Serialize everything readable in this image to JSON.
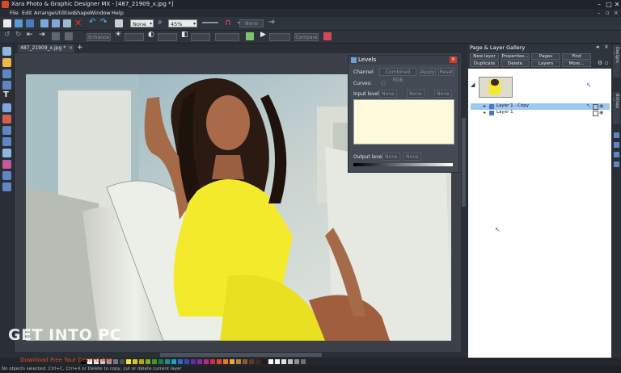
{
  "window": {
    "title": "Xara Photo & Graphic Designer MX - [487_21909_x.jpg *]",
    "controls": [
      "–",
      "□",
      "✕"
    ]
  },
  "menu": [
    "File",
    "Edit",
    "Arrange",
    "Utilities",
    "Shape",
    "Window",
    "Help"
  ],
  "toolbar": {
    "line_style": "None",
    "zoom": "45%",
    "shadow_field": "None"
  },
  "toolbar2": {
    "btn_enhance": "Enhance",
    "btn_compare": "Compare"
  },
  "document_tab": {
    "label": "487_21909_x.jpg *",
    "add": "+"
  },
  "levels": {
    "title": "Levels",
    "channel_label": "Channel",
    "channel_value": "Combined RGB",
    "auto_button": "Apply",
    "reset_button": "Reset",
    "curves_label": "Curves:",
    "input_label": "Input levels:",
    "output_label": "Output levels:",
    "input_fields": [
      "None",
      "None",
      "None"
    ],
    "output_fields": [
      "None",
      "None"
    ]
  },
  "gallery": {
    "title": "Page & Layer Gallery",
    "buttons_row1": [
      "New layer",
      "Properties...",
      "Pages",
      "Find"
    ],
    "buttons_row2": [
      "Duplicate",
      "Delete",
      "Layers",
      "More..."
    ],
    "layers": [
      {
        "name": "Layer 1 - Copy",
        "selected": true
      },
      {
        "name": "Layer 1",
        "selected": false
      }
    ]
  },
  "right_tabs": [
    "Designs gallery",
    "Bitmap gallery"
  ],
  "status": {
    "text": "No objects selected: Ctrl+C, Ctrl+X or Delete to copy, cut or delete current layer"
  },
  "watermark": {
    "main": "GET INTO PC",
    "sub": "Download Free Your Desired App"
  },
  "colors": {
    "accent_selection": "#9cc8f2",
    "dress_yellow": "#f2ea2a",
    "app_bg": "#2b3038"
  },
  "palette": [
    "#000000",
    "#ffffff",
    "#e8e8e8",
    "#c8c8c8",
    "#a0a0a0",
    "#787878",
    "#505050",
    "#f2ea2a",
    "#d9c61c",
    "#b5a70e",
    "#7fae18",
    "#3c9a32",
    "#1c7a3c",
    "#1e8f7f",
    "#1fa0c4",
    "#2d6dc8",
    "#3848b8",
    "#5b2fa8",
    "#8a2aa0",
    "#b8287e",
    "#d42a4a",
    "#e04a22",
    "#e8782a",
    "#f0a830",
    "#c08040",
    "#8a5a30",
    "#603820",
    "#40281a",
    "#2a1a10",
    "#ffffff",
    "#f4f4f4",
    "#e0e0e0",
    "#c0c0c0",
    "#909090",
    "#707070"
  ]
}
